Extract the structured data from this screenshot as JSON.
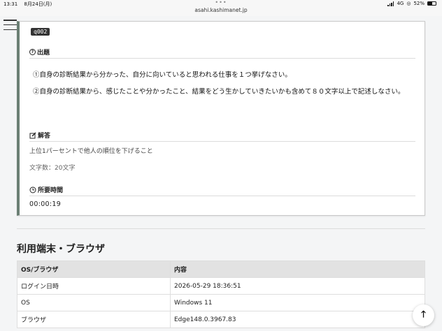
{
  "status_bar": {
    "time": "13:31",
    "date": "8月24日(月)",
    "network": "4G",
    "battery": "52%",
    "battery_level": 0.52
  },
  "browser": {
    "url": "asahi.kashimanet.jp"
  },
  "question_card": {
    "id": "q002",
    "question_heading": "出題",
    "question_lines": [
      "①自身の診断結果から分かった、自分に向いていると思われる仕事を１つ挙げなさい。",
      "②自身の診断結果から、感じたことや分かったこと、結果をどう生かしていきたいかも含めて８０文字以上で記述しなさい。"
    ],
    "answer_heading": "解答",
    "answer_text": "上位1パーセントで他人の順位を下げること",
    "char_count": "文字数：20文字",
    "time_heading": "所要時間",
    "time_value": "00:00:19"
  },
  "device_section": {
    "title": "利用端末・ブラウザ",
    "headers": [
      "OS/ブラウザ",
      "内容"
    ],
    "rows": [
      [
        "ログイン日時",
        "2026-05-29 18:36:51"
      ],
      [
        "OS",
        "Windows 11"
      ],
      [
        "ブラウザ",
        "Edge148.0.3967.83"
      ]
    ]
  },
  "icons": {
    "menu": "hamburger-icon",
    "question": "question-circle-icon",
    "answer": "edit-icon",
    "time": "clock-icon",
    "scroll_top": "arrow-up-icon"
  }
}
